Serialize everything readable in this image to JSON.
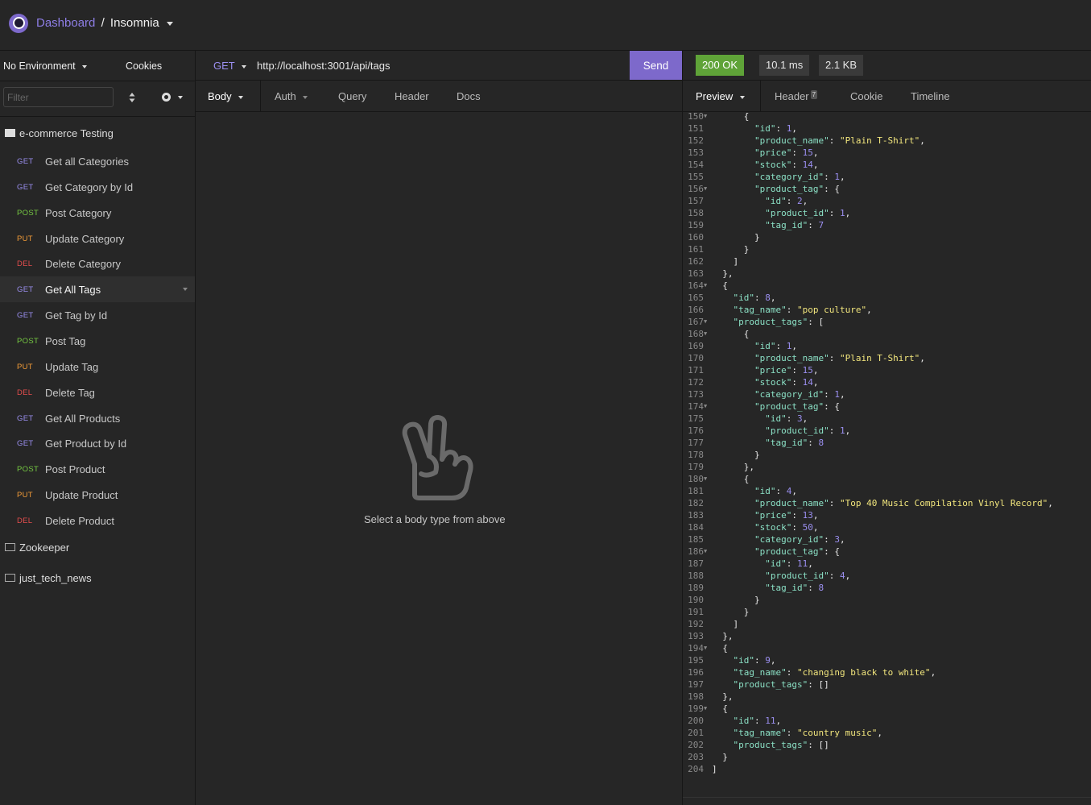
{
  "header": {
    "breadcrumb_root": "Dashboard",
    "separator": "/",
    "workspace": "Insomnia"
  },
  "sidebar": {
    "environment": "No Environment",
    "cookies": "Cookies",
    "filter_placeholder": "Filter",
    "folder_open": "e-commerce Testing",
    "requests": [
      {
        "method": "GET",
        "name": "Get all Categories"
      },
      {
        "method": "GET",
        "name": "Get Category by Id"
      },
      {
        "method": "POST",
        "name": "Post Category"
      },
      {
        "method": "PUT",
        "name": "Update Category"
      },
      {
        "method": "DEL",
        "name": "Delete Category"
      },
      {
        "method": "GET",
        "name": "Get All Tags"
      },
      {
        "method": "GET",
        "name": "Get Tag by Id"
      },
      {
        "method": "POST",
        "name": "Post Tag"
      },
      {
        "method": "PUT",
        "name": "Update Tag"
      },
      {
        "method": "DEL",
        "name": "Delete Tag"
      },
      {
        "method": "GET",
        "name": "Get All Products"
      },
      {
        "method": "GET",
        "name": "Get Product by Id"
      },
      {
        "method": "POST",
        "name": "Post Product"
      },
      {
        "method": "PUT",
        "name": "Update Product"
      },
      {
        "method": "DEL",
        "name": "Delete Product"
      }
    ],
    "active_request": "Get All Tags",
    "folders_closed": [
      "Zookeeper",
      "just_tech_news"
    ]
  },
  "request": {
    "method": "GET",
    "url": "http://localhost:3001/api/tags",
    "send_label": "Send",
    "tabs": [
      "Body",
      "Auth",
      "Query",
      "Header",
      "Docs"
    ],
    "empty_text": "Select a body type from above"
  },
  "response": {
    "status": "200 OK",
    "time": "10.1 ms",
    "size": "2.1 KB",
    "tabs": [
      "Preview",
      "Header",
      "Cookie",
      "Timeline"
    ],
    "header_count": "7",
    "lines": [
      {
        "n": "150",
        "fold": true,
        "text": "      {"
      },
      {
        "n": "151",
        "text": "        \"id\": 1,"
      },
      {
        "n": "152",
        "text": "        \"product_name\": \"Plain T-Shirt\","
      },
      {
        "n": "153",
        "text": "        \"price\": 15,"
      },
      {
        "n": "154",
        "text": "        \"stock\": 14,"
      },
      {
        "n": "155",
        "text": "        \"category_id\": 1,"
      },
      {
        "n": "156",
        "fold": true,
        "text": "        \"product_tag\": {"
      },
      {
        "n": "157",
        "text": "          \"id\": 2,"
      },
      {
        "n": "158",
        "text": "          \"product_id\": 1,"
      },
      {
        "n": "159",
        "text": "          \"tag_id\": 7"
      },
      {
        "n": "160",
        "text": "        }"
      },
      {
        "n": "161",
        "text": "      }"
      },
      {
        "n": "162",
        "text": "    ]"
      },
      {
        "n": "163",
        "text": "  },"
      },
      {
        "n": "164",
        "fold": true,
        "text": "  {"
      },
      {
        "n": "165",
        "text": "    \"id\": 8,"
      },
      {
        "n": "166",
        "text": "    \"tag_name\": \"pop culture\","
      },
      {
        "n": "167",
        "fold": true,
        "text": "    \"product_tags\": ["
      },
      {
        "n": "168",
        "fold": true,
        "text": "      {"
      },
      {
        "n": "169",
        "text": "        \"id\": 1,"
      },
      {
        "n": "170",
        "text": "        \"product_name\": \"Plain T-Shirt\","
      },
      {
        "n": "171",
        "text": "        \"price\": 15,"
      },
      {
        "n": "172",
        "text": "        \"stock\": 14,"
      },
      {
        "n": "173",
        "text": "        \"category_id\": 1,"
      },
      {
        "n": "174",
        "fold": true,
        "text": "        \"product_tag\": {"
      },
      {
        "n": "175",
        "text": "          \"id\": 3,"
      },
      {
        "n": "176",
        "text": "          \"product_id\": 1,"
      },
      {
        "n": "177",
        "text": "          \"tag_id\": 8"
      },
      {
        "n": "178",
        "text": "        }"
      },
      {
        "n": "179",
        "text": "      },"
      },
      {
        "n": "180",
        "fold": true,
        "text": "      {"
      },
      {
        "n": "181",
        "text": "        \"id\": 4,"
      },
      {
        "n": "182",
        "text": "        \"product_name\": \"Top 40 Music Compilation Vinyl Record\","
      },
      {
        "n": "183",
        "text": "        \"price\": 13,"
      },
      {
        "n": "184",
        "text": "        \"stock\": 50,"
      },
      {
        "n": "185",
        "text": "        \"category_id\": 3,"
      },
      {
        "n": "186",
        "fold": true,
        "text": "        \"product_tag\": {"
      },
      {
        "n": "187",
        "text": "          \"id\": 11,"
      },
      {
        "n": "188",
        "text": "          \"product_id\": 4,"
      },
      {
        "n": "189",
        "text": "          \"tag_id\": 8"
      },
      {
        "n": "190",
        "text": "        }"
      },
      {
        "n": "191",
        "text": "      }"
      },
      {
        "n": "192",
        "text": "    ]"
      },
      {
        "n": "193",
        "text": "  },"
      },
      {
        "n": "194",
        "fold": true,
        "text": "  {"
      },
      {
        "n": "195",
        "text": "    \"id\": 9,"
      },
      {
        "n": "196",
        "text": "    \"tag_name\": \"changing black to white\","
      },
      {
        "n": "197",
        "text": "    \"product_tags\": []"
      },
      {
        "n": "198",
        "text": "  },"
      },
      {
        "n": "199",
        "fold": true,
        "text": "  {"
      },
      {
        "n": "200",
        "text": "    \"id\": 11,"
      },
      {
        "n": "201",
        "text": "    \"tag_name\": \"country music\","
      },
      {
        "n": "202",
        "text": "    \"product_tags\": []"
      },
      {
        "n": "203",
        "text": "  }"
      },
      {
        "n": "204",
        "text": "]"
      }
    ]
  },
  "colors": {
    "accent": "#7d69cb",
    "get": "#9b8ff0",
    "post": "#75c742",
    "put": "#f39c38",
    "del": "#e44d4d",
    "ok": "#5fa338"
  }
}
